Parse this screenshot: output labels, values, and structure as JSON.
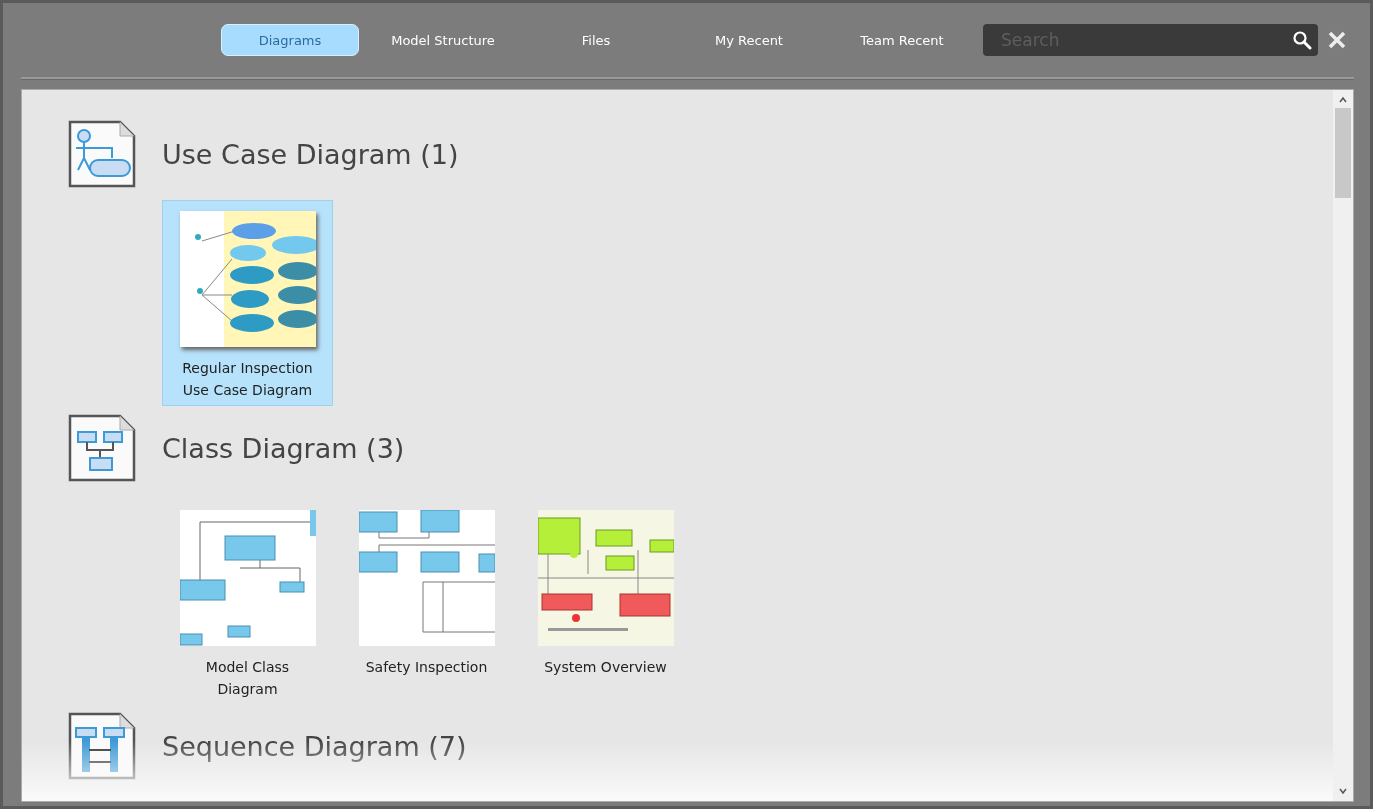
{
  "tabs": [
    {
      "label": "Diagrams",
      "selected": true
    },
    {
      "label": "Model Structure",
      "selected": false
    },
    {
      "label": "Files",
      "selected": false
    },
    {
      "label": "My Recent",
      "selected": false
    },
    {
      "label": "Team Recent",
      "selected": false
    }
  ],
  "search": {
    "placeholder": "Search"
  },
  "sections": [
    {
      "kind": "usecase",
      "title": "Use Case Diagram (1)",
      "items": [
        {
          "kind": "usecase",
          "label": "Regular Inspection Use Case Diagram",
          "selected": true
        }
      ]
    },
    {
      "kind": "class",
      "title": "Class Diagram (3)",
      "items": [
        {
          "kind": "model",
          "label": "Model Class Diagram",
          "selected": false
        },
        {
          "kind": "safety",
          "label": "Safety Inspection",
          "selected": false
        },
        {
          "kind": "overview",
          "label": "System Overview",
          "selected": false
        }
      ]
    },
    {
      "kind": "sequence",
      "title": "Sequence Diagram (7)"
    }
  ]
}
